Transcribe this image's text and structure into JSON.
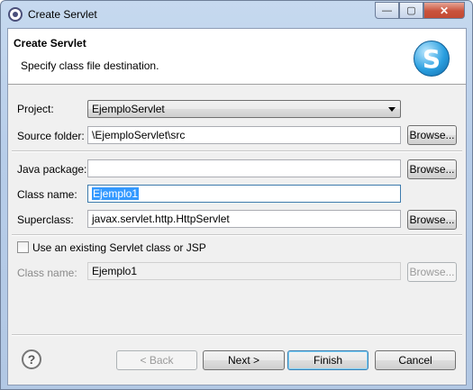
{
  "window": {
    "title": "Create Servlet",
    "controls": {
      "minimize": "—",
      "maximize": "▢",
      "close": "✕"
    }
  },
  "header": {
    "title": "Create Servlet",
    "subtitle": "Specify class file destination.",
    "logo_letter": "S"
  },
  "form": {
    "project": {
      "label": "Project:",
      "value": "EjemploServlet"
    },
    "source_folder": {
      "label": "Source folder:",
      "value": "\\EjemploServlet\\src",
      "browse": "Browse..."
    },
    "java_package": {
      "label": "Java package:",
      "value": "",
      "browse": "Browse..."
    },
    "class_name": {
      "label": "Class name:",
      "value": "Ejemplo1"
    },
    "superclass": {
      "label": "Superclass:",
      "value": "javax.servlet.http.HttpServlet",
      "browse": "Browse..."
    },
    "use_existing": {
      "label": "Use an existing Servlet class or JSP",
      "checked": false
    },
    "existing_class": {
      "label": "Class name:",
      "value": "Ejemplo1",
      "browse": "Browse..."
    }
  },
  "footer": {
    "help_icon": "?",
    "back": "< Back",
    "next": "Next >",
    "finish": "Finish",
    "cancel": "Cancel"
  }
}
